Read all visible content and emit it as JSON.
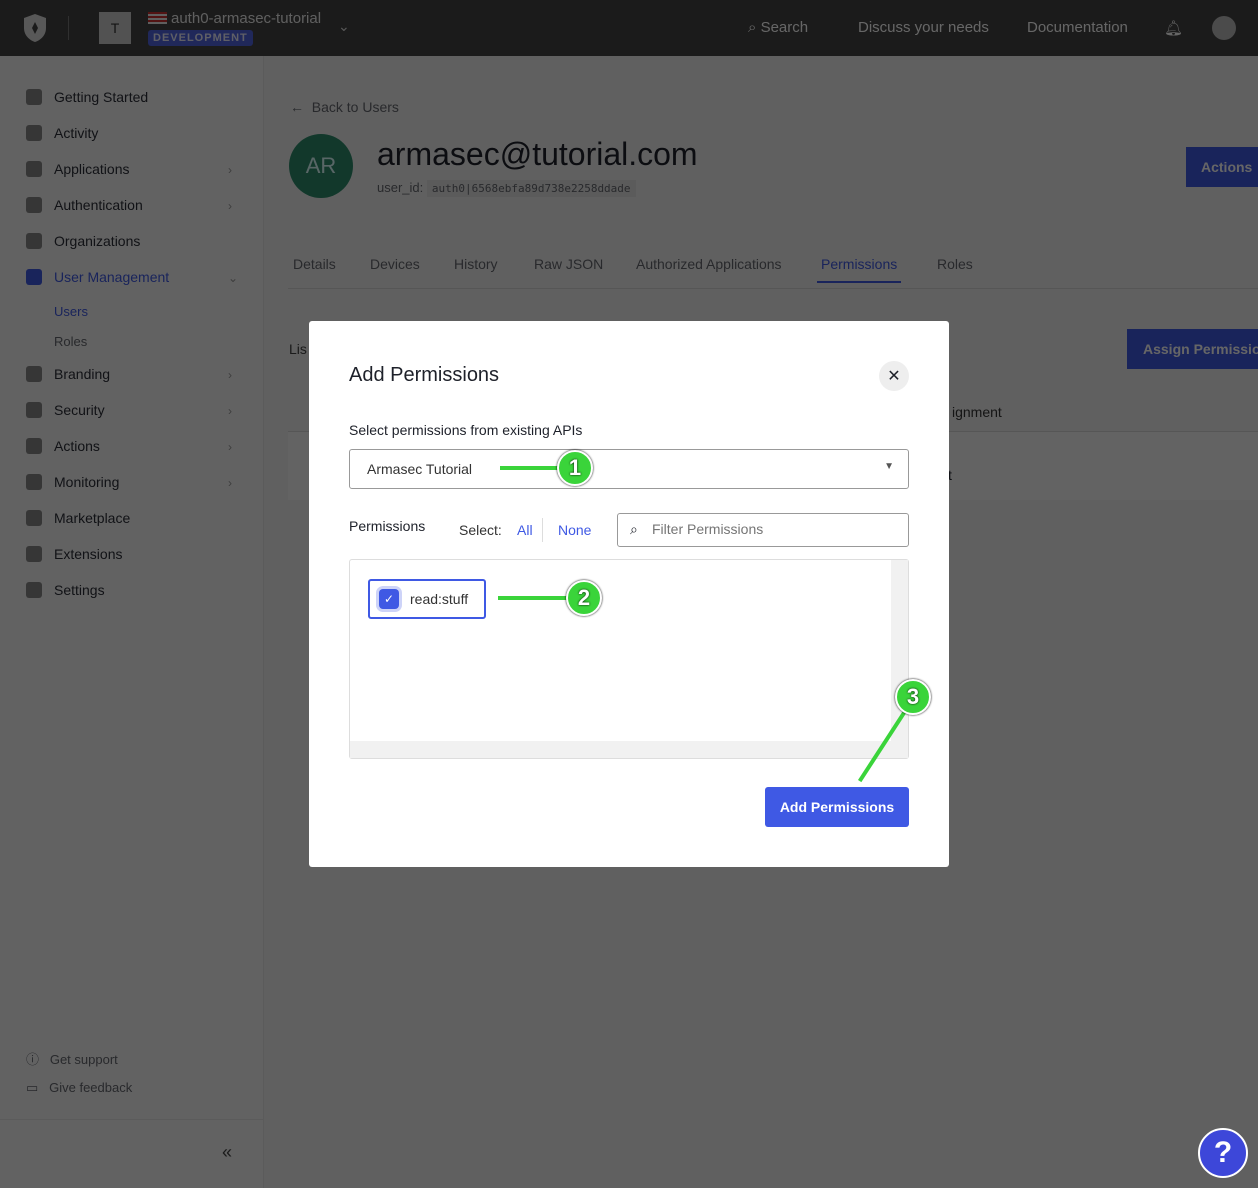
{
  "topbar": {
    "tenant_initial": "T",
    "tenant_name": "auth0-armasec-tutorial",
    "environment": "DEVELOPMENT",
    "search": "Search",
    "discuss": "Discuss your needs",
    "docs": "Documentation"
  },
  "sidebar": {
    "items": [
      {
        "label": "Getting Started",
        "icon": "bolt-icon"
      },
      {
        "label": "Activity",
        "icon": "chart-icon"
      },
      {
        "label": "Applications",
        "icon": "layers-icon"
      },
      {
        "label": "Authentication",
        "icon": "lock-icon"
      },
      {
        "label": "Organizations",
        "icon": "building-icon"
      },
      {
        "label": "User Management",
        "icon": "users-icon"
      },
      {
        "label": "Branding",
        "icon": "brush-icon"
      },
      {
        "label": "Security",
        "icon": "shield-icon"
      },
      {
        "label": "Actions",
        "icon": "actions-icon"
      },
      {
        "label": "Monitoring",
        "icon": "bar-chart-icon"
      },
      {
        "label": "Marketplace",
        "icon": "grid-plus-icon"
      },
      {
        "label": "Extensions",
        "icon": "puzzle-icon"
      },
      {
        "label": "Settings",
        "icon": "gear-icon"
      }
    ],
    "sub_items": [
      "Users",
      "Roles"
    ],
    "support": "Get support",
    "feedback": "Give feedback"
  },
  "user": {
    "back": "Back to Users",
    "initials": "AR",
    "email": "armasec@tutorial.com",
    "user_id_label": "user_id:",
    "user_id": "auth0|6568ebfa89d738e2258ddade",
    "actions": "Actions",
    "avatar_color": "#2d8c6c"
  },
  "tabs": [
    "Details",
    "Devices",
    "History",
    "Raw JSON",
    "Authorized Applications",
    "Permissions",
    "Roles"
  ],
  "permissions_tab": {
    "list_label": "Lis",
    "assign": "Assign Permissio",
    "col_partial": "ignment",
    "cell_partial": "t"
  },
  "modal": {
    "title": "Add Permissions",
    "api_label": "Select permissions from existing APIs",
    "api_value": "Armasec Tutorial",
    "perm_label": "Permissions",
    "select_label": "Select:",
    "all": "All",
    "none": "None",
    "filter_placeholder": "Filter Permissions",
    "permission": "read:stuff",
    "permission_checked": true,
    "submit": "Add Permissions"
  },
  "annotations": [
    "1",
    "2",
    "3"
  ],
  "help": "?"
}
